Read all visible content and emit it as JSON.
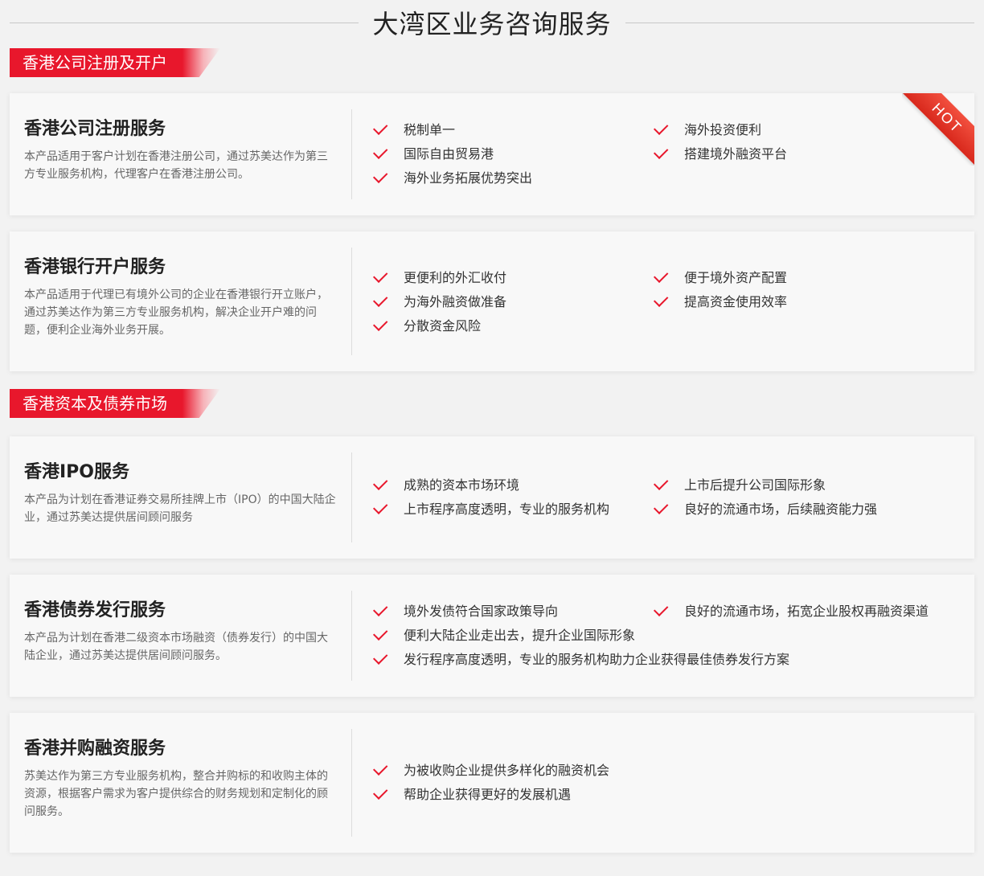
{
  "page": {
    "title": "大湾区业务咨询服务"
  },
  "sections": [
    {
      "label": "香港公司注册及开户"
    },
    {
      "label": "香港资本及债券市场"
    }
  ],
  "badge": {
    "hot": "HOT"
  },
  "cards": [
    {
      "title": "香港公司注册服务",
      "desc": "本产品适用于客户计划在香港注册公司，通过苏美达作为第三方专业服务机构，代理客户在香港注册公司。",
      "features": [
        "税制单一",
        "国际自由贸易港",
        "海外业务拓展优势突出",
        "海外投资便利",
        "搭建境外融资平台"
      ]
    },
    {
      "title": "香港银行开户服务",
      "desc": "本产品适用于代理已有境外公司的企业在香港银行开立账户，通过苏美达作为第三方专业服务机构，解决企业开户难的问题，便利企业海外业务开展。",
      "features": [
        "更便利的外汇收付",
        "为海外融资做准备",
        "分散资金风险",
        "便于境外资产配置",
        "提高资金使用效率"
      ]
    },
    {
      "title": "香港IPO服务",
      "desc": "本产品为计划在香港证券交易所挂牌上市（IPO）的中国大陆企业，通过苏美达提供居间顾问服务",
      "features": [
        "成熟的资本市场环境",
        "上市程序高度透明，专业的服务机构",
        "上市后提升公司国际形象",
        "良好的流通市场，后续融资能力强"
      ]
    },
    {
      "title": "香港债券发行服务",
      "desc": "本产品为计划在香港二级资本市场融资（债券发行）的中国大陆企业，通过苏美达提供居间顾问服务。",
      "features": [
        "境外发债符合国家政策导向",
        "便利大陆企业走出去，提升企业国际形象",
        "发行程序高度透明，专业的服务机构助力企业获得最佳债券发行方案",
        "良好的流通市场，拓宽企业股权再融资渠道"
      ]
    },
    {
      "title": "香港并购融资服务",
      "desc": "苏美达作为第三方专业服务机构，整合并购标的和收购主体的资源，根据客户需求为客户提供综合的财务规划和定制化的顾问服务。",
      "features": [
        "为被收购企业提供多样化的融资机会",
        "帮助企业获得更好的发展机遇"
      ]
    }
  ]
}
